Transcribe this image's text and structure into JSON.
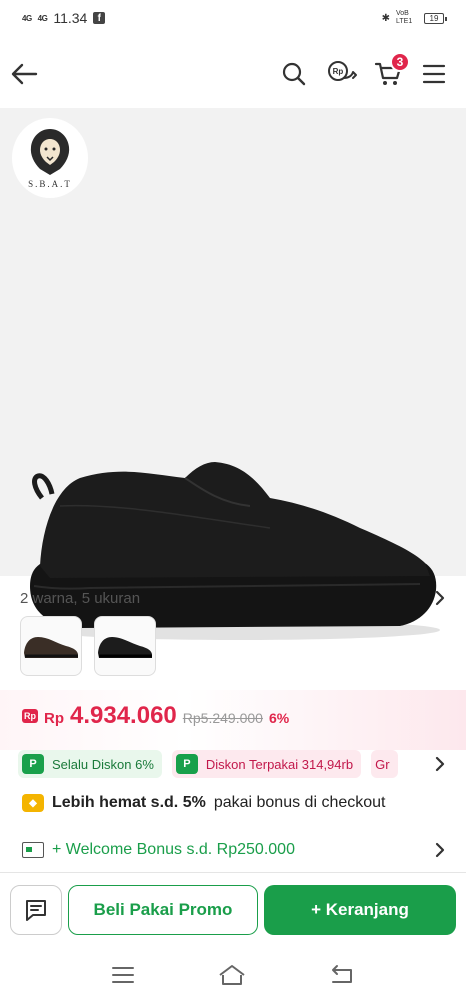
{
  "status_bar": {
    "signal1": "4G",
    "signal2": "4G",
    "time": "11.34",
    "fb": "f",
    "volte": "VoB LTE1",
    "battery": "19"
  },
  "header": {
    "cart_count": "3"
  },
  "product": {
    "brand_name": "S.B.A.T",
    "variants_text": "2 warna, 5 ukuran"
  },
  "price": {
    "icon": "Rp",
    "currency": "Rp",
    "current": "4.934.060",
    "original": "Rp5.249.000",
    "discount": "6%"
  },
  "promos": [
    {
      "icon": "P",
      "label": "Selalu Diskon 6%"
    },
    {
      "icon": "P",
      "label": "Diskon Terpakai 314,94rb"
    },
    {
      "icon": "",
      "label": "Gr"
    }
  ],
  "bonus": {
    "bold": "Lebih hemat s.d. 5%",
    "rest": "pakai bonus di checkout"
  },
  "welcome": {
    "label": "+ Welcome Bonus s.d. Rp250.000"
  },
  "actions": {
    "promo_label": "Beli Pakai Promo",
    "cart_label": "+ Keranjang"
  },
  "colors": {
    "brand_green": "#1a9e4a",
    "price_red": "#e0264b"
  }
}
